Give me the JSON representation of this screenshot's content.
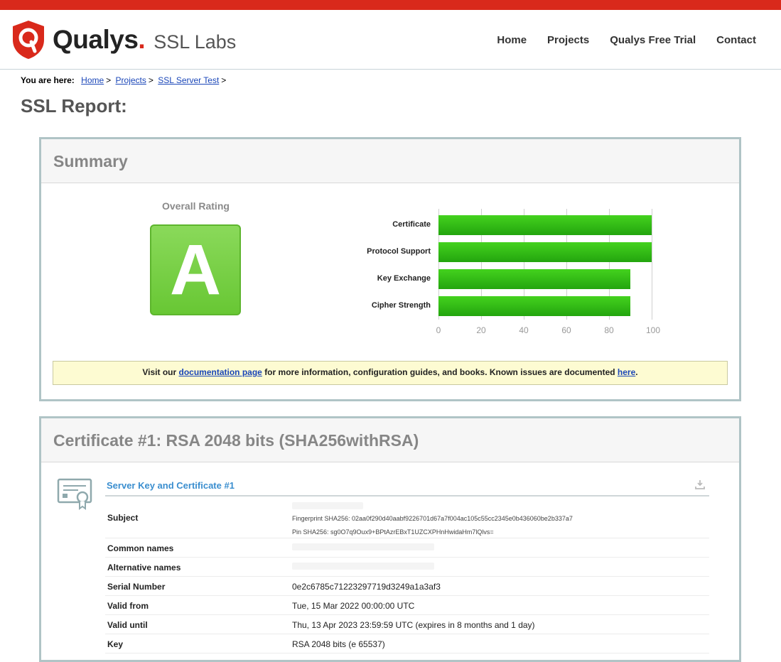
{
  "header": {
    "brand": "Qualys",
    "brand_dot": ".",
    "product": "SSL Labs",
    "nav": [
      "Home",
      "Projects",
      "Qualys Free Trial",
      "Contact"
    ]
  },
  "breadcrumb": {
    "lead": "You are here:",
    "items": [
      "Home",
      "Projects",
      "SSL Server Test"
    ],
    "sep": ">"
  },
  "page_title": "SSL Report:",
  "summary": {
    "title": "Summary",
    "rating_label": "Overall Rating",
    "grade": "A",
    "notice": {
      "prefix": "Visit our",
      "link1": "documentation page",
      "middle": "for more information, configuration guides, and books. Known issues are documented",
      "link2": "here",
      "suffix": "."
    }
  },
  "chart_data": {
    "type": "bar",
    "orientation": "horizontal",
    "categories": [
      "Certificate",
      "Protocol Support",
      "Key Exchange",
      "Cipher Strength"
    ],
    "values": [
      100,
      100,
      90,
      90
    ],
    "xlim": [
      0,
      100
    ],
    "ticks": [
      0,
      20,
      40,
      60,
      80,
      100
    ],
    "grid": true,
    "bar_color": "#33bb17"
  },
  "certificate": {
    "title": "Certificate #1: RSA 2048 bits (SHA256withRSA)",
    "section": "Server Key and Certificate #1",
    "rows": [
      {
        "key": "Subject",
        "lines": [
          "Fingerprint SHA256: 02aa0f290d40aabf9226701d67a7f004ac105c55cc2345e0b436060be2b337a7",
          "Pin SHA256: sg0O7q9Oux9+BPtAzrEBxT1UZCXPHnHwidaHm7lQlvs="
        ]
      },
      {
        "key": "Common names",
        "value": ""
      },
      {
        "key": "Alternative names",
        "value": ""
      },
      {
        "key": "Serial Number",
        "value": "0e2c6785c71223297719d3249a1a3af3"
      },
      {
        "key": "Valid from",
        "value": "Tue, 15 Mar 2022 00:00:00 UTC"
      },
      {
        "key": "Valid until",
        "value": "Thu, 13 Apr 2023 23:59:59 UTC (expires in 8 months and 1 day)"
      },
      {
        "key": "Key",
        "value": "RSA 2048 bits (e 65537)"
      }
    ]
  },
  "colors": {
    "top_bar": "#d9291b",
    "grade_green": "#68c734",
    "link": "#1a46b8",
    "panel_border": "#b0c4c6"
  }
}
